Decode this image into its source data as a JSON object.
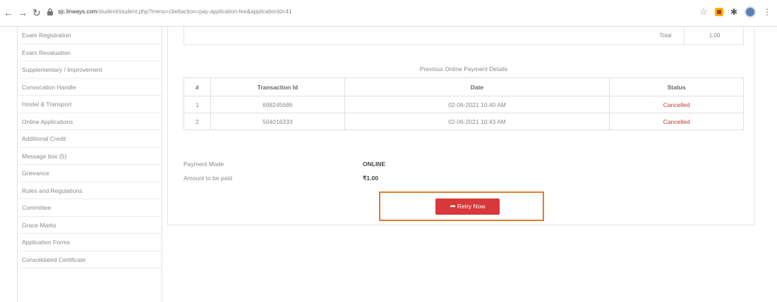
{
  "browser": {
    "url_host": "sjc.linways.com",
    "url_path": "/student/student.php?menu=cbeltaction=pay-application-fee&applicationId=41"
  },
  "sidebar": {
    "items": [
      {
        "label": "Exam Registration"
      },
      {
        "label": "Exam Revaluation"
      },
      {
        "label": "Supplementary / Improvement"
      },
      {
        "label": "Convocation Handle"
      },
      {
        "label": "Hostel & Transport"
      },
      {
        "label": "Online Applications"
      },
      {
        "label": "Additional Credit"
      },
      {
        "label": "Message box (5)"
      },
      {
        "label": "Grievance"
      },
      {
        "label": "Rules and Regulations"
      },
      {
        "label": "Committee"
      },
      {
        "label": "Grace Marks"
      },
      {
        "label": "Application Forms"
      },
      {
        "label": "Consolidated Certificate"
      }
    ]
  },
  "main": {
    "total_label": "Total",
    "total_value": "1.00",
    "section_title": "Previous Online Payment Details",
    "table": {
      "headers": [
        "#",
        "Transaction Id",
        "Date",
        "Status"
      ],
      "rows": [
        {
          "num": "1",
          "txn_id": "698245686",
          "date": "02-06-2021 10:40 AM",
          "status": "Cancelled"
        },
        {
          "num": "2",
          "txn_id": "504016333",
          "date": "02-06-2021 10:43 AM",
          "status": "Cancelled"
        }
      ]
    },
    "payment_mode_label": "Payment Mode",
    "payment_mode_value": "ONLINE",
    "amount_label": "Amount to be paid",
    "amount_value": "₹1.00",
    "retry_label": "Retry Now"
  },
  "colors": {
    "accent_red": "#d9383a",
    "highlight_orange": "#e07c2d",
    "status_red": "#c0392b"
  }
}
